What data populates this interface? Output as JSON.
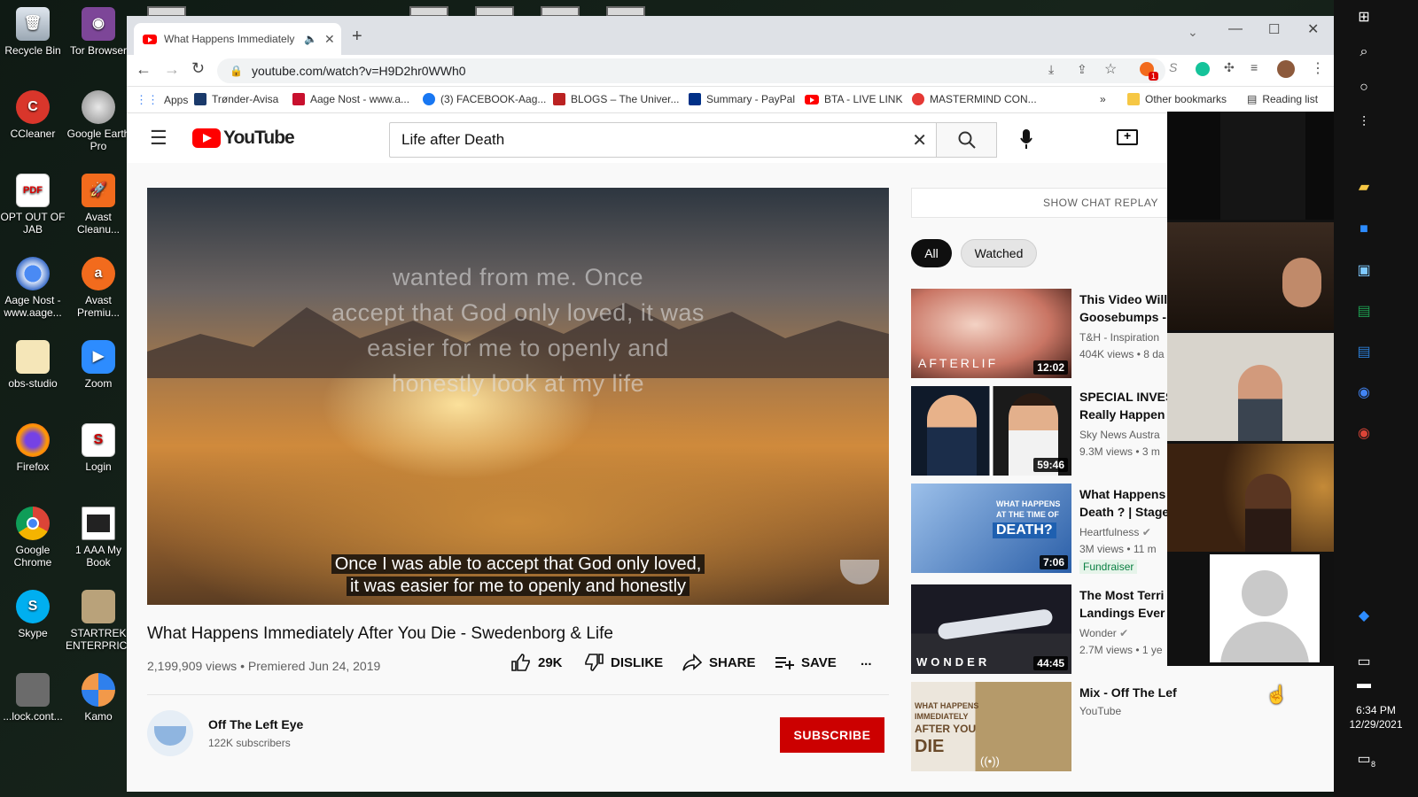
{
  "desktop": {
    "icons": [
      {
        "label": "Recycle Bin",
        "icon": "recycle-bin-icon"
      },
      {
        "label": "Tor Browser",
        "icon": "tor-browser-icon"
      },
      {
        "label": "CCleaner",
        "icon": "ccleaner-icon"
      },
      {
        "label": "Google Earth Pro",
        "icon": "google-earth-icon"
      },
      {
        "label": "OPT OUT OF JAB",
        "icon": "pdf-icon"
      },
      {
        "label": "Avast Cleanu...",
        "icon": "avast-cleanup-icon"
      },
      {
        "label": "Aage Nost - www.aage...",
        "icon": "chrome-shortcut-icon"
      },
      {
        "label": "Avast Premiu...",
        "icon": "avast-premium-icon"
      },
      {
        "label": "obs-studio",
        "icon": "obs-icon"
      },
      {
        "label": "Zoom",
        "icon": "zoom-icon"
      },
      {
        "label": "Firefox",
        "icon": "firefox-icon"
      },
      {
        "label": "Login",
        "icon": "login-icon"
      },
      {
        "label": "Google Chrome",
        "icon": "chrome-icon"
      },
      {
        "label": "1 AAA My Book",
        "icon": "book-icon"
      },
      {
        "label": "Skype",
        "icon": "skype-icon"
      },
      {
        "label": "STARTREK ENTERPRICE",
        "icon": "startrek-icon"
      },
      {
        "label": "...lock.cont...",
        "icon": "file-icon"
      },
      {
        "label": "Kamo",
        "icon": "kamo-icon"
      }
    ],
    "pdf_badge": "PDF"
  },
  "browser": {
    "tab_title": "What Happens Immediately",
    "new_tab": "+",
    "url": "youtube.com/watch?v=H9D2hr0WWh0",
    "extension_badge": "1",
    "bookmarks": [
      {
        "label": "Apps"
      },
      {
        "label": "Trønder-Avisa"
      },
      {
        "label": "Aage Nost - www.a..."
      },
      {
        "label": "(3) FACEBOOK-Aag..."
      },
      {
        "label": "BLOGS – The Univer..."
      },
      {
        "label": "Summary - PayPal"
      },
      {
        "label": "BTA - LIVE LINK"
      },
      {
        "label": "MASTERMIND CON..."
      }
    ],
    "bookmarks_more": "»",
    "other_bookmarks": "Other bookmarks",
    "reading_list": "Reading list"
  },
  "youtube": {
    "logo_text": "YouTube",
    "search_value": "Life after Death",
    "video": {
      "overlay_lines": [
        "wanted from me. Once",
        "accept that God only loved, it was",
        "easier for me to openly and",
        "honestly look at my life"
      ],
      "caption_line1": "Once I was able to accept that God only loved,",
      "caption_line2": "it was easier for me to openly and honestly",
      "title": "What Happens Immediately After You Die - Swedenborg & Life",
      "meta": "2,199,909 views • Premiered Jun 24, 2019",
      "likes": "29K",
      "dislike": "DISLIKE",
      "share": "SHARE",
      "save": "SAVE",
      "more": "..."
    },
    "channel": {
      "name": "Off The Left Eye",
      "subscribers": "122K subscribers",
      "subscribe": "SUBSCRIBE"
    },
    "chat_replay": "SHOW CHAT REPLAY",
    "chips": [
      "All",
      "Watched"
    ],
    "recommendations": [
      {
        "title1": "This Video Will",
        "title2": "Goosebumps -",
        "channel": "T&H - Inspiration",
        "stats": "404K views • 8 da",
        "duration": "12:02",
        "thumb_text": "AFTERLIF"
      },
      {
        "title1": "SPECIAL INVES",
        "title2": "Really Happen",
        "channel": "Sky News Austra",
        "stats": "9.3M views • 3 m",
        "duration": "59:46"
      },
      {
        "title1": "What Happens",
        "title2": "Death ? | Stage",
        "channel": "Heartfulness",
        "stats": "3M views • 11 m",
        "duration": "7:06",
        "badge": "Fundraiser",
        "thumb_text1": "WHAT HAPPENS",
        "thumb_text2": "AT THE TIME OF",
        "thumb_text3": "DEATH?"
      },
      {
        "title1": "The Most Terri",
        "title2": "Landings Ever",
        "channel": "Wonder",
        "stats": "2.7M views • 1 ye",
        "duration": "44:45",
        "thumb_text": "WONDER"
      },
      {
        "title1": "Mix - Off The Left Eye",
        "channel": "YouTube",
        "thumb_text1": "WHAT HAPPENS",
        "thumb_text2": "IMMEDIATELY",
        "thumb_text3": "AFTER YOU",
        "thumb_text4": "DIE"
      }
    ]
  },
  "taskbar": {
    "time": "6:34 PM",
    "date": "12/29/2021",
    "notification_count": "8"
  },
  "colors": {
    "youtube_red": "#ff0000",
    "subscribe_red": "#cc0000",
    "fundraiser_green": "#0b8043"
  }
}
